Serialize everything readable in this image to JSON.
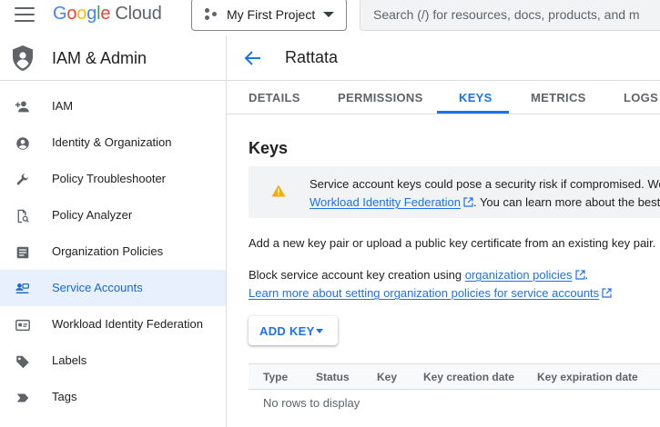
{
  "topbar": {
    "logo_letters": [
      "G",
      "o",
      "o",
      "g",
      "l",
      "e"
    ],
    "logo_product": "Cloud",
    "project_name": "My First Project",
    "search_placeholder": "Search (/) for resources, docs, products, and m"
  },
  "sidebar": {
    "title": "IAM & Admin",
    "items": [
      {
        "label": "IAM",
        "icon": "person-add-icon"
      },
      {
        "label": "Identity & Organization",
        "icon": "account-circle-icon"
      },
      {
        "label": "Policy Troubleshooter",
        "icon": "wrench-icon"
      },
      {
        "label": "Policy Analyzer",
        "icon": "document-search-icon"
      },
      {
        "label": "Organization Policies",
        "icon": "list-alt-icon"
      },
      {
        "label": "Service Accounts",
        "icon": "service-account-icon",
        "active": true
      },
      {
        "label": "Workload Identity Federation",
        "icon": "id-card-icon"
      },
      {
        "label": "Labels",
        "icon": "label-tag-icon"
      },
      {
        "label": "Tags",
        "icon": "tag-arrow-icon"
      }
    ]
  },
  "page": {
    "title": "Rattata",
    "tabs": [
      {
        "label": "DETAILS"
      },
      {
        "label": "PERMISSIONS"
      },
      {
        "label": "KEYS",
        "active": true
      },
      {
        "label": "METRICS"
      },
      {
        "label": "LOGS"
      }
    ]
  },
  "keys": {
    "heading": "Keys",
    "warning_line1": "Service account keys could pose a security risk if compromised. We",
    "warning_link": "Workload Identity Federation",
    "warning_line2_rest": ". You can learn more about the best",
    "intro": "Add a new key pair or upload a public key certificate from an existing key pair.",
    "block_text": "Block service account key creation using ",
    "block_link": "organization policies",
    "block_end": ".",
    "learn_more_link": "Learn more about setting organization policies for service accounts",
    "add_key_label": "ADD KEY",
    "table_columns": [
      "Type",
      "Status",
      "Key",
      "Key creation date",
      "Key expiration date"
    ],
    "empty_message": "No rows to display"
  },
  "colors": {
    "accent": "#1a73e8",
    "active_bg": "#e8f0fe",
    "warning": "#f9ab00"
  }
}
